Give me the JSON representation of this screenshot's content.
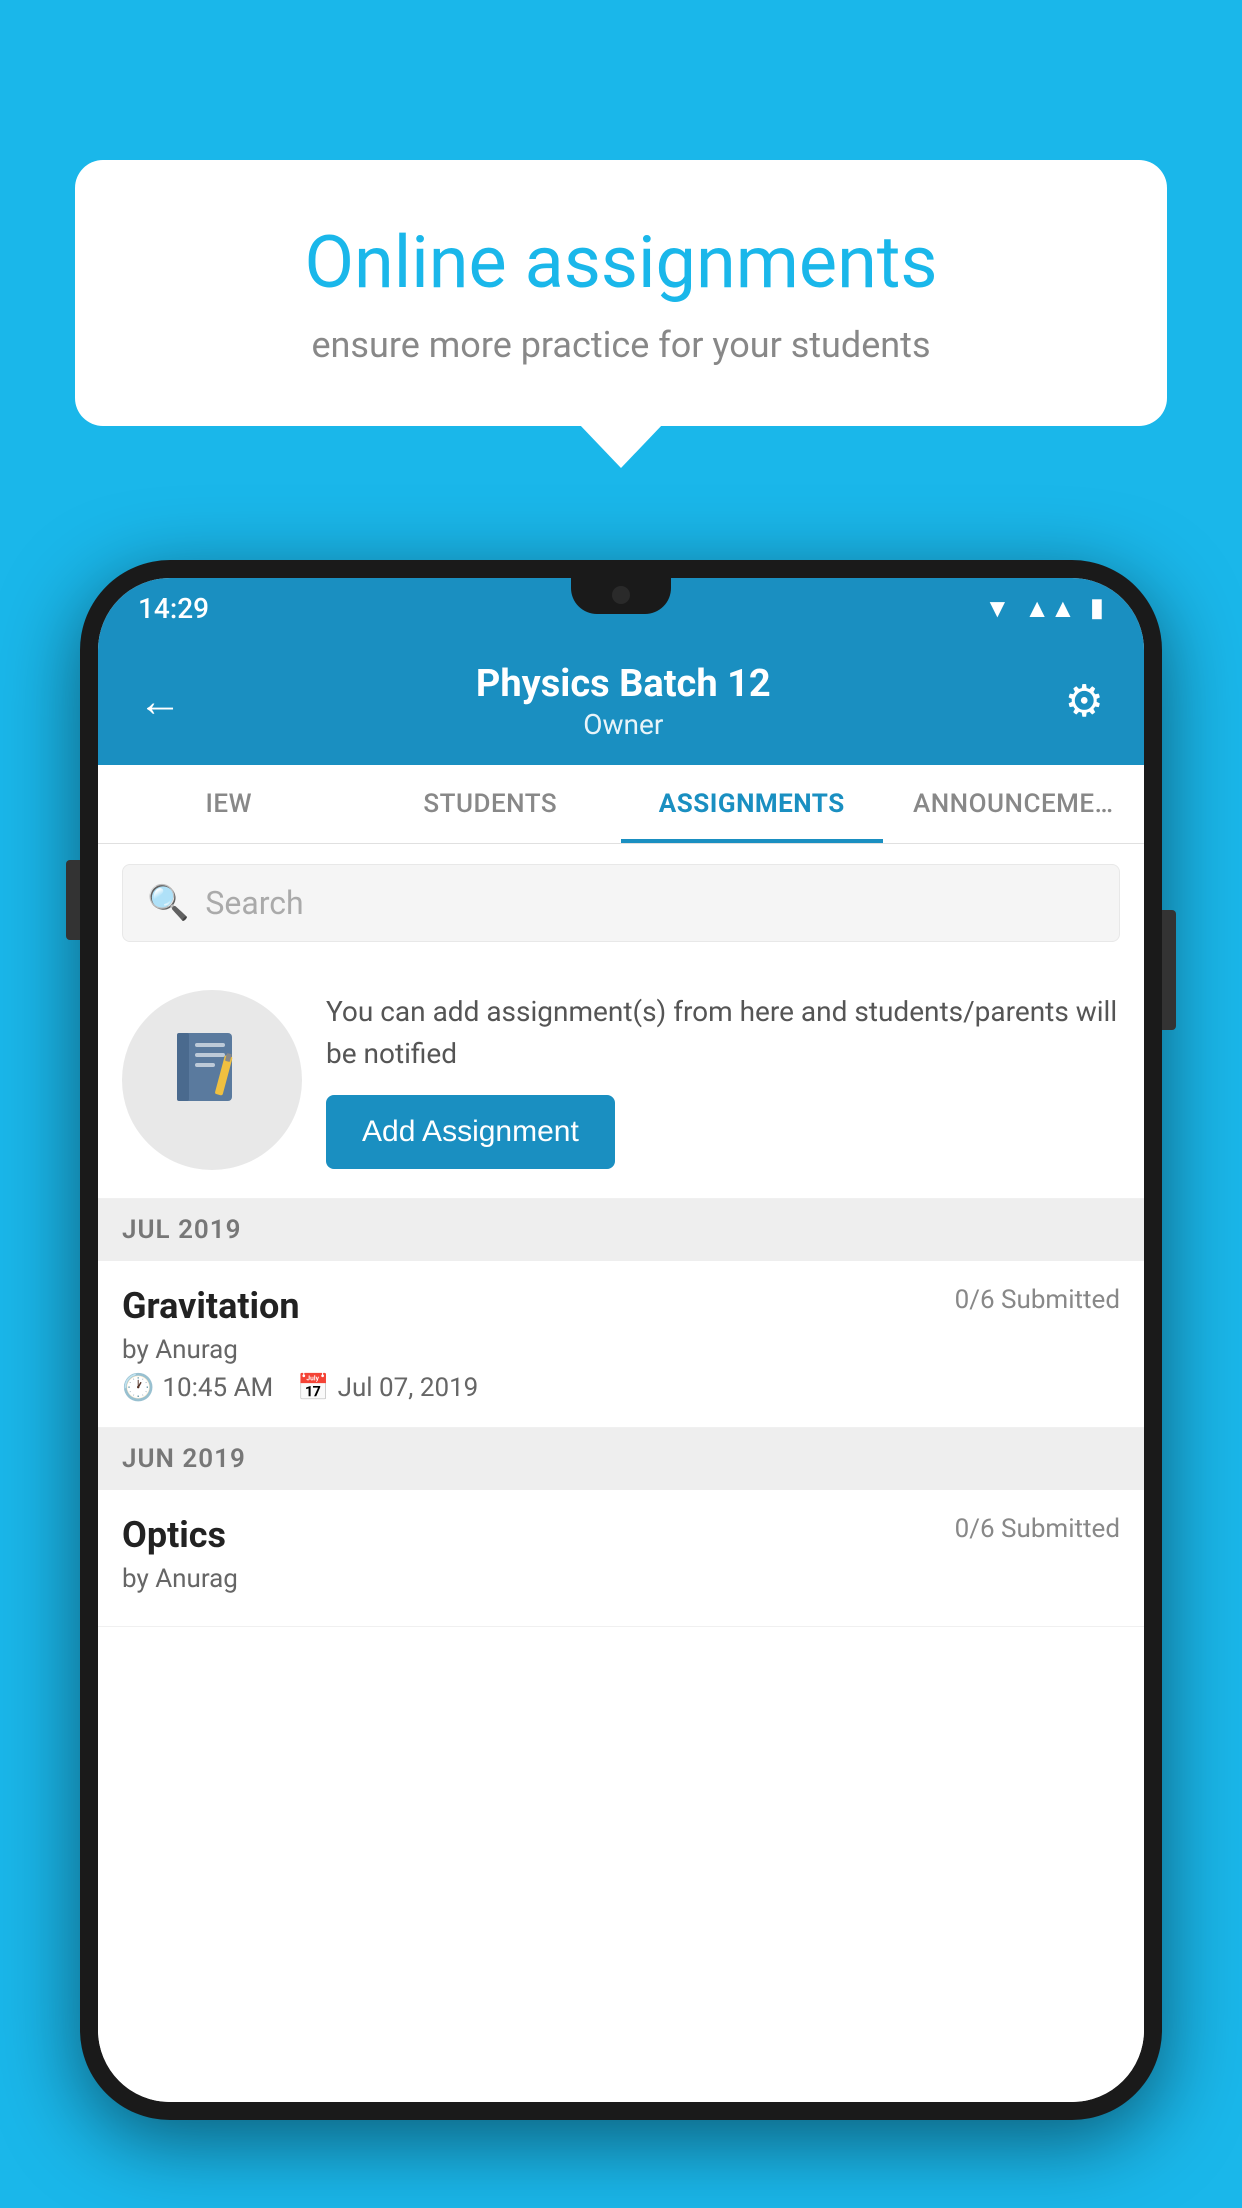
{
  "background": {
    "color": "#1ab7ea"
  },
  "speech_bubble": {
    "title": "Online assignments",
    "subtitle": "ensure more practice for your students"
  },
  "status_bar": {
    "time": "14:29",
    "wifi_symbol": "▼",
    "signal_symbol": "▲",
    "battery_symbol": "▮"
  },
  "app_header": {
    "back_icon": "←",
    "title": "Physics Batch 12",
    "subtitle": "Owner",
    "settings_icon": "⚙"
  },
  "tabs": [
    {
      "label": "IEW",
      "active": false
    },
    {
      "label": "STUDENTS",
      "active": false
    },
    {
      "label": "ASSIGNMENTS",
      "active": true
    },
    {
      "label": "ANNOUNCEM…",
      "active": false
    }
  ],
  "search": {
    "placeholder": "Search",
    "icon": "🔍"
  },
  "info_card": {
    "icon": "📓",
    "text": "You can add assignment(s) from here and students/parents will be notified",
    "button_label": "Add Assignment"
  },
  "sections": [
    {
      "label": "JUL 2019",
      "assignments": [
        {
          "name": "Gravitation",
          "submitted": "0/6 Submitted",
          "by": "by Anurag",
          "time": "10:45 AM",
          "date": "Jul 07, 2019"
        }
      ]
    },
    {
      "label": "JUN 2019",
      "assignments": [
        {
          "name": "Optics",
          "submitted": "0/6 Submitted",
          "by": "by Anurag",
          "time": "",
          "date": ""
        }
      ]
    }
  ]
}
